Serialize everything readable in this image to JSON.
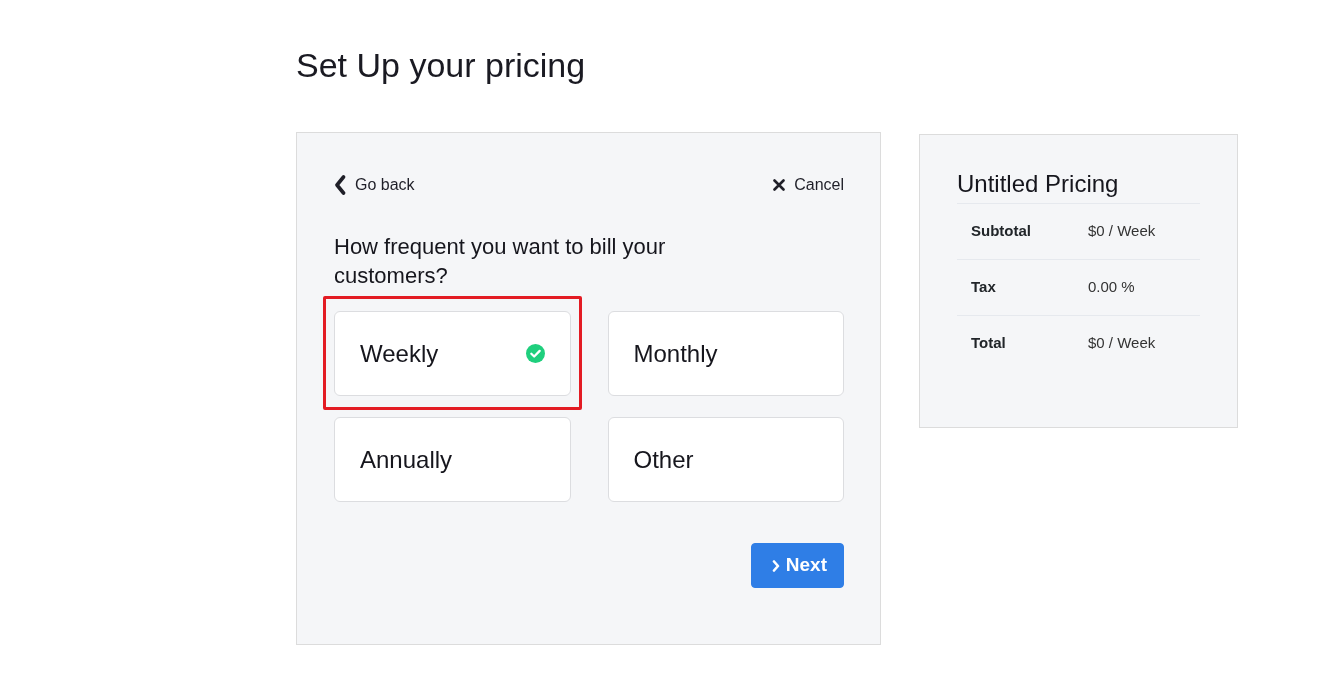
{
  "page": {
    "title": "Set Up your pricing"
  },
  "wizard": {
    "back_link": "Go back",
    "cancel_link": "Cancel",
    "question": "How frequent you want to bill your customers?",
    "options": [
      {
        "label": "Weekly",
        "selected": true,
        "highlighted": true
      },
      {
        "label": "Monthly",
        "selected": false,
        "highlighted": false
      },
      {
        "label": "Annually",
        "selected": false,
        "highlighted": false
      },
      {
        "label": "Other",
        "selected": false,
        "highlighted": false
      }
    ],
    "next_button": "Next"
  },
  "summary": {
    "title": "Untitled Pricing",
    "rows": [
      {
        "label": "Subtotal",
        "value": "$0 / Week"
      },
      {
        "label": "Tax",
        "value": "0.00 %"
      },
      {
        "label": "Total",
        "value": "$0 / Week"
      }
    ]
  }
}
